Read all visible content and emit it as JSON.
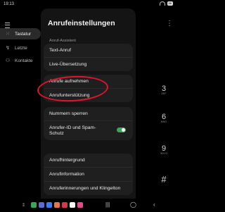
{
  "status": {
    "time": "19:13",
    "battery": "86"
  },
  "sidebar": {
    "items": [
      {
        "label": "Tastatur",
        "icon": "dialpad-icon"
      },
      {
        "label": "Letzte",
        "icon": "recent-calls-icon"
      },
      {
        "label": "Kontakte",
        "icon": "contacts-icon"
      }
    ]
  },
  "dialpad": {
    "digits": [
      {
        "digit": "3",
        "letters": "DEF"
      },
      {
        "digit": "6",
        "letters": "MNO"
      },
      {
        "digit": "9",
        "letters": "WXYZ"
      },
      {
        "digit": "#",
        "letters": ""
      }
    ]
  },
  "panel": {
    "title": "Anrufeinstellungen",
    "section_label": "Anruf-Assistent",
    "group1": [
      "Text-Anruf",
      "Live-Übersetzung"
    ],
    "group2": [
      "Anrufe aufnehmen",
      "Anrufunterstützung"
    ],
    "group3": [
      "Nummern sperren",
      "Anrufer-ID und Spam-Schutz"
    ],
    "group4": [
      "Anrufhintergrund",
      "Anrufinformation",
      "Anruferinnerungen und Klingelton"
    ]
  },
  "colors": {
    "accent": "#3ea35b",
    "annotation": "#e0152c"
  }
}
